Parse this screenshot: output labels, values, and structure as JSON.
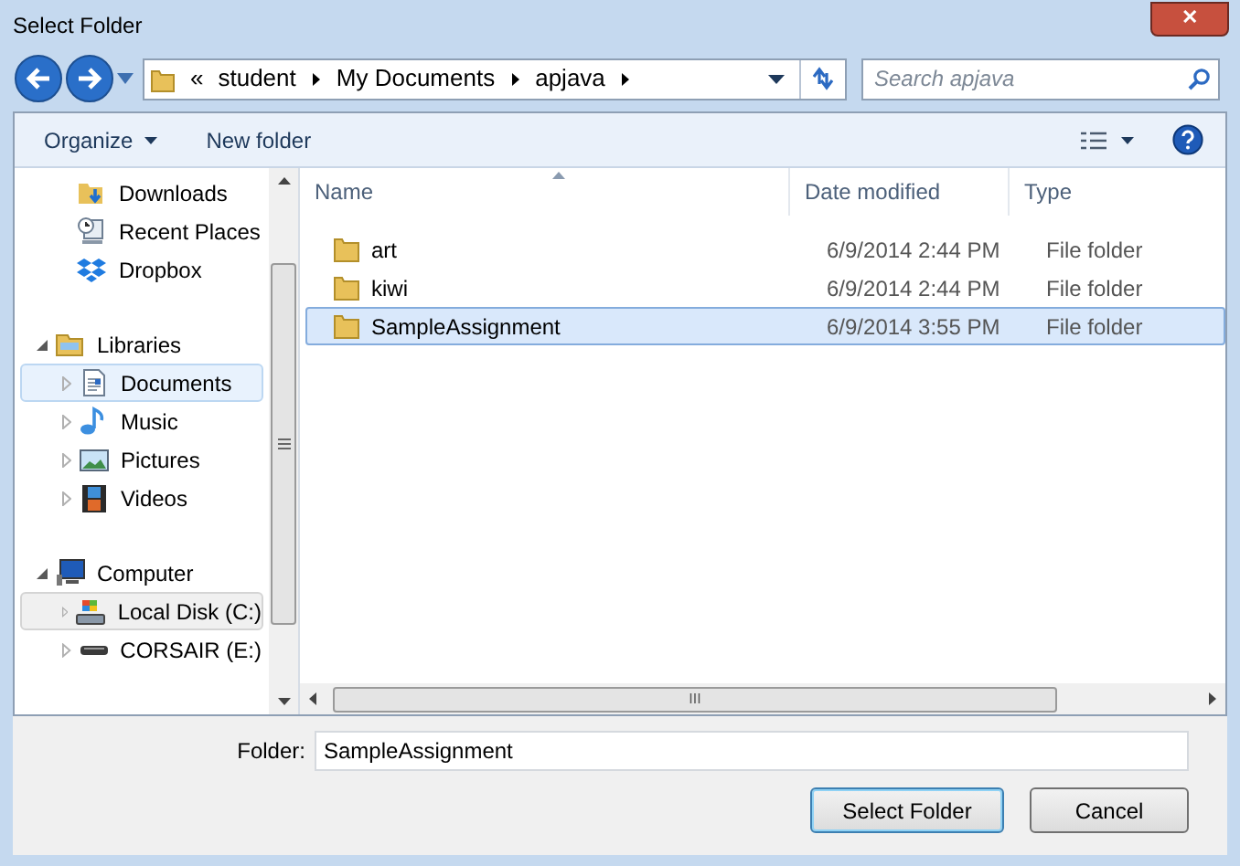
{
  "window": {
    "title": "Select Folder",
    "close": "✕"
  },
  "address": {
    "overflow": "«",
    "crumbs": [
      "student",
      "My Documents",
      "apjava"
    ]
  },
  "search": {
    "placeholder": "Search apjava"
  },
  "toolbar": {
    "organize": "Organize",
    "new_folder": "New folder"
  },
  "sidebar": {
    "items": [
      {
        "label": "Downloads",
        "kind": "downloads",
        "selected": false
      },
      {
        "label": "Recent Places",
        "kind": "recent",
        "selected": false
      },
      {
        "label": "Dropbox",
        "kind": "dropbox",
        "selected": false
      },
      {
        "label": "Libraries",
        "kind": "library",
        "selected": false,
        "expanded": true,
        "children": [
          {
            "label": "Documents",
            "kind": "documents",
            "selected": true
          },
          {
            "label": "Music",
            "kind": "music",
            "selected": false
          },
          {
            "label": "Pictures",
            "kind": "pictures",
            "selected": false
          },
          {
            "label": "Videos",
            "kind": "videos",
            "selected": false
          }
        ]
      },
      {
        "label": "Computer",
        "kind": "computer",
        "selected": false,
        "expanded": true,
        "children": [
          {
            "label": "Local Disk (C:)",
            "kind": "disk",
            "selected": false,
            "hovered": true
          },
          {
            "label": "CORSAIR (E:)",
            "kind": "drive",
            "selected": false
          }
        ]
      }
    ]
  },
  "table": {
    "columns": [
      "Name",
      "Date modified",
      "Type"
    ],
    "rows": [
      {
        "name": "art",
        "date": "6/9/2014 2:44 PM",
        "type": "File folder",
        "selected": false
      },
      {
        "name": "kiwi",
        "date": "6/9/2014 2:44 PM",
        "type": "File folder",
        "selected": false
      },
      {
        "name": "SampleAssignment",
        "date": "6/9/2014 3:55 PM",
        "type": "File folder",
        "selected": true
      }
    ]
  },
  "folder_field": {
    "label": "Folder:",
    "value": "SampleAssignment"
  },
  "buttons": [
    "Select Folder",
    "Cancel"
  ],
  "scrollbar_grip": "III"
}
